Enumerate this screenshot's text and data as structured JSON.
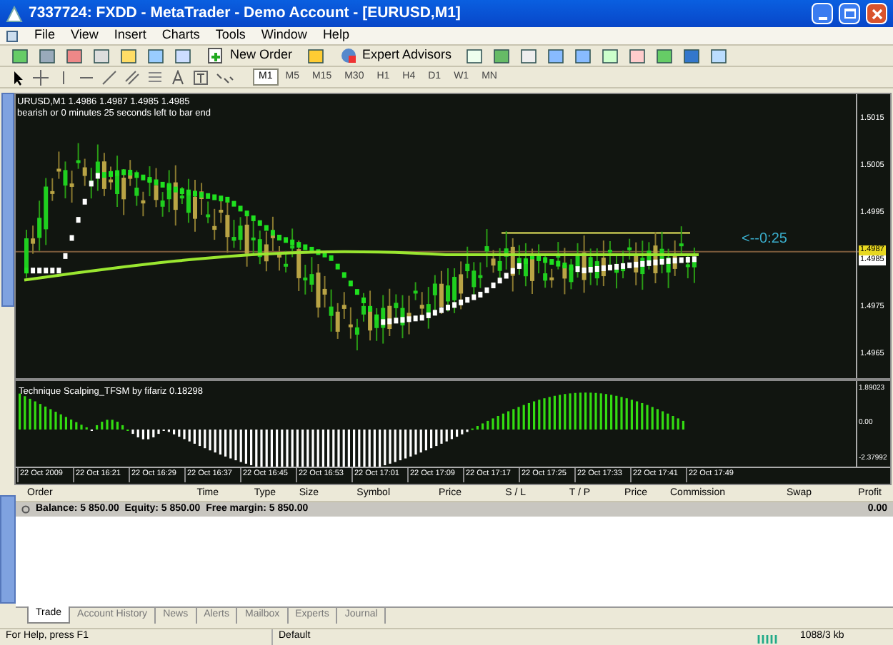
{
  "window": {
    "title": "7337724: FXDD - MetaTrader - Demo Account - [EURUSD,M1]"
  },
  "menu": [
    "File",
    "View",
    "Insert",
    "Charts",
    "Tools",
    "Window",
    "Help"
  ],
  "toolbar": {
    "new_order": "New Order",
    "expert_advisors": "Expert Advisors"
  },
  "timeframes": [
    {
      "label": "M1",
      "selected": true
    },
    {
      "label": "M5",
      "selected": false
    },
    {
      "label": "M15",
      "selected": false
    },
    {
      "label": "M30",
      "selected": false
    },
    {
      "label": "H1",
      "selected": false
    },
    {
      "label": "H4",
      "selected": false
    },
    {
      "label": "D1",
      "selected": false
    },
    {
      "label": "W1",
      "selected": false
    },
    {
      "label": "MN",
      "selected": false
    }
  ],
  "chart": {
    "header": "URUSD,M1  1.4986 1.4987 1.4985 1.4985",
    "status": "bearish or 0 minutes 25 seconds left to bar end",
    "countdown": "<--0:25",
    "price_labels": [
      {
        "text": "1.5015",
        "kind": "tick"
      },
      {
        "text": "1.5005",
        "kind": "tick"
      },
      {
        "text": "1.4995",
        "kind": "tick"
      },
      {
        "text": "1.4987",
        "kind": "ask"
      },
      {
        "text": "1.4985",
        "kind": "bid"
      },
      {
        "text": "1.4975",
        "kind": "tick"
      },
      {
        "text": "1.4965",
        "kind": "tick"
      }
    ],
    "indicator": {
      "title": "Technique Scalping_TFSM by fifariz 0.18298",
      "scale": [
        "1.89023",
        "0.00",
        "-2.37992"
      ]
    },
    "time_labels": [
      "22 Oct 2009",
      "22 Oct 16:21",
      "22 Oct 16:29",
      "22 Oct 16:37",
      "22 Oct 16:45",
      "22 Oct 16:53",
      "22 Oct 17:01",
      "22 Oct 17:09",
      "22 Oct 17:17",
      "22 Oct 17:25",
      "22 Oct 17:33",
      "22 Oct 17:41",
      "22 Oct 17:49"
    ]
  },
  "terminal": {
    "columns": [
      "Order",
      "Time",
      "Type",
      "Size",
      "Symbol",
      "Price",
      "S / L",
      "T / P",
      "Price",
      "Commission",
      "Swap",
      "Profit"
    ],
    "balance": "Balance: 5 850.00  Equity: 5 850.00  Free margin: 5 850.00",
    "profit": "0.00",
    "tabs": [
      {
        "label": "Trade",
        "selected": true
      },
      {
        "label": "Account History",
        "selected": false
      },
      {
        "label": "News",
        "selected": false
      },
      {
        "label": "Alerts",
        "selected": false
      },
      {
        "label": "Mailbox",
        "selected": false
      },
      {
        "label": "Experts",
        "selected": false
      },
      {
        "label": "Journal",
        "selected": false
      }
    ]
  },
  "status_bar": {
    "help": "For Help, press F1",
    "profile": "Default",
    "traffic": "1088/3 kb"
  }
}
